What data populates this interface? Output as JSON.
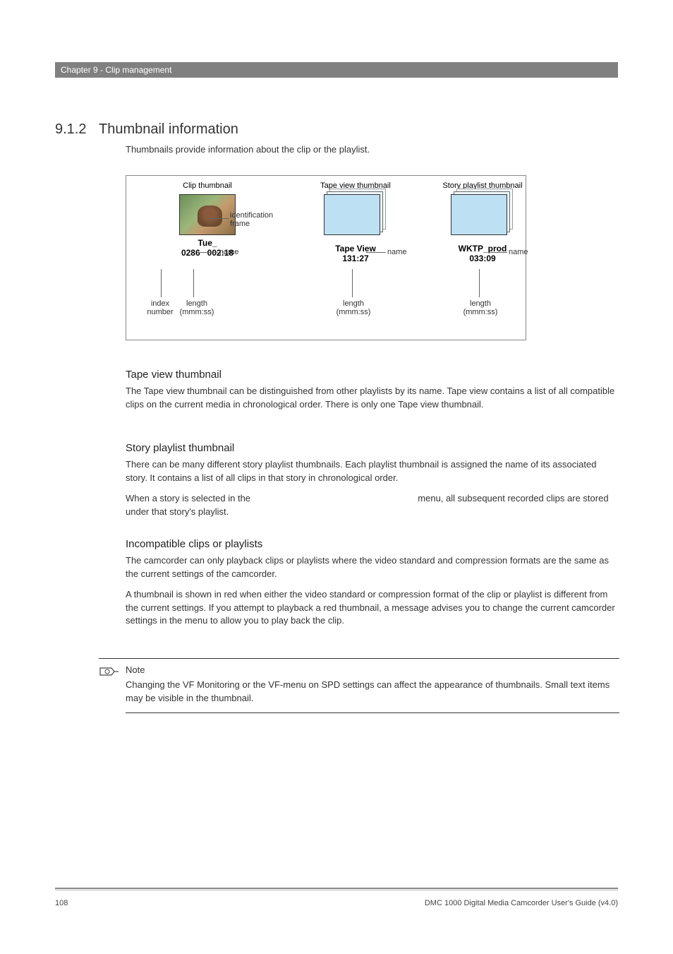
{
  "header": {
    "chapter": "Chapter 9 - Clip management"
  },
  "section": {
    "number": "9.1.2",
    "title": "Thumbnail information"
  },
  "intro": "Thumbnails provide information about the clip or the playlist.",
  "diagram": {
    "col1": {
      "title": "Clip thumbnail",
      "name": "Tue_",
      "index": "0286",
      "length": "002:18",
      "anno_idframe": "identification frame",
      "anno_name": "name",
      "anno_index": "index number",
      "anno_length": "length (mmm:ss)"
    },
    "col2": {
      "title": "Tape view thumbnail",
      "name": "Tape View",
      "length": "131:27",
      "anno_name": "name",
      "anno_length": "length (mmm:ss)"
    },
    "col3": {
      "title": "Story playlist thumbnail",
      "name": "WKTP_prod",
      "length": "033:09",
      "anno_name": "name",
      "anno_length": "length (mmm:ss)"
    }
  },
  "subsections": {
    "tape": {
      "title": "Tape view thumbnail",
      "p1": "The Tape view thumbnail can be distinguished from other playlists by its name. Tape view contains a list of all compatible clips on the current media in chronological order. There is only one Tape view thumbnail."
    },
    "story": {
      "title": "Story playlist thumbnail",
      "p1": "There can be many different story playlist thumbnails. Each playlist thumbnail is assigned the name of its associated story. It contains a list of all clips in that story in chronological order.",
      "p2a": "When a story is selected in the ",
      "p2b": " menu, all subsequent recorded clips are stored under that story's playlist."
    },
    "incompat": {
      "title": "Incompatible clips or playlists",
      "p1": "The camcorder can only playback clips or playlists where the video standard and compression formats are the same as the current settings of the camcorder.",
      "p2": "A thumbnail is shown in red when either the video standard or compression format of the clip or playlist is different from the current settings. If you attempt to playback a red thumbnail, a message advises you to change the current camcorder settings in the                              menu to allow you to play back the clip."
    }
  },
  "note": {
    "title": "Note",
    "text": "Changing the VF Monitoring or the VF-menu on SPD settings can affect the appearance of thumbnails. Small text items may be visible in the thumbnail."
  },
  "footer": {
    "page": "108",
    "text": "DMC 1000 Digital Media Camcorder User's Guide (v4.0)"
  }
}
